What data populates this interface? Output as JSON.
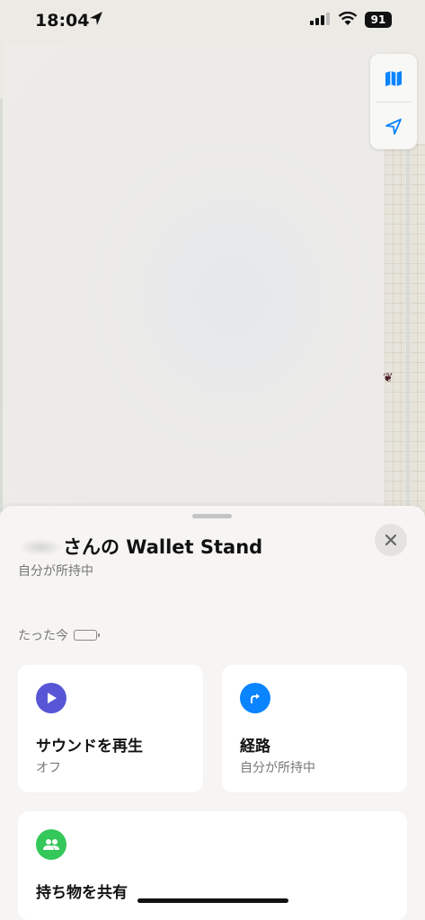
{
  "status_bar": {
    "time": "18:04",
    "battery": "91"
  },
  "map": {
    "controls": [
      "map-icon",
      "location-arrow-icon"
    ]
  },
  "sheet": {
    "title_suffix": "さんの Wallet Stand",
    "subtitle": "自分が所持中",
    "timestamp": "たった今",
    "cards": [
      {
        "label": "サウンドを再生",
        "sub": "オフ",
        "icon": "play-icon",
        "color": "#5856d6"
      },
      {
        "label": "経路",
        "sub": "自分が所持中",
        "icon": "directions-icon",
        "color": "#0a84ff"
      },
      {
        "label": "持ち物を共有",
        "sub": "",
        "icon": "people-icon",
        "color": "#34c759"
      }
    ]
  }
}
